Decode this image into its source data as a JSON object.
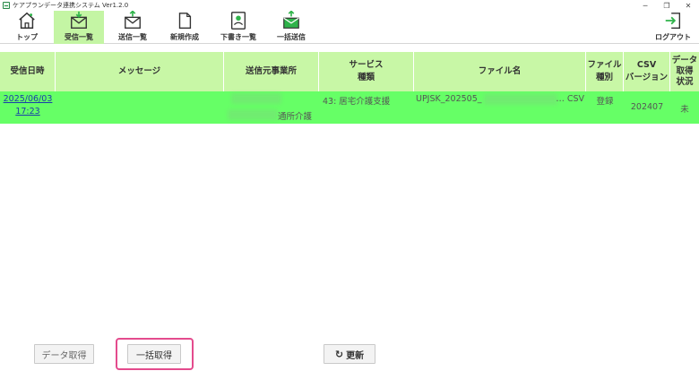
{
  "window": {
    "title": "ケアプランデータ連携システム Ver1.2.0",
    "minimize": "─",
    "restore": "❐",
    "close": "✕"
  },
  "toolbar": {
    "items": [
      {
        "label": "トップ",
        "icon": "home-icon",
        "active": false
      },
      {
        "label": "受信一覧",
        "icon": "inbox-icon",
        "active": true
      },
      {
        "label": "送信一覧",
        "icon": "outbox-icon",
        "active": false
      },
      {
        "label": "新規作成",
        "icon": "new-document-icon",
        "active": false
      },
      {
        "label": "下書き一覧",
        "icon": "draft-icon",
        "active": false
      },
      {
        "label": "一括送信",
        "icon": "bulk-send-icon",
        "active": false
      }
    ],
    "logout": {
      "label": "ログアウト",
      "icon": "logout-icon"
    }
  },
  "table": {
    "headers": {
      "received_at": "受信日時",
      "message": "メッセージ",
      "sender": "送信元事業所",
      "service_line1": "サービス",
      "service_line2": "種類",
      "filename": "ファイル名",
      "file_type_line1": "ファイル",
      "file_type_line2": "種別",
      "csv_line1": "CSV",
      "csv_line2": "バージョン",
      "status_line1": "データ",
      "status_line2": "取得",
      "status_line3": "状況"
    },
    "rows": [
      {
        "date": "2025/06/03",
        "time": "17:23",
        "message": "",
        "sender_suffix": "通所介護",
        "service": "43: 居宅介護支援",
        "filename_prefix": "UPJSK_202505_",
        "filename_suffix": "… CSV",
        "file_type": "登録",
        "csv_version": "202407",
        "status": "未"
      }
    ]
  },
  "buttons": {
    "fetch": "データ取得",
    "bulk_fetch": "一括取得",
    "refresh": "更新",
    "refresh_glyph": "↻"
  },
  "colors": {
    "header_bg": "#c8f7a6",
    "row_bg": "#66ff66",
    "active_tab": "#c4f5a4",
    "highlight": "#e44b8d"
  }
}
